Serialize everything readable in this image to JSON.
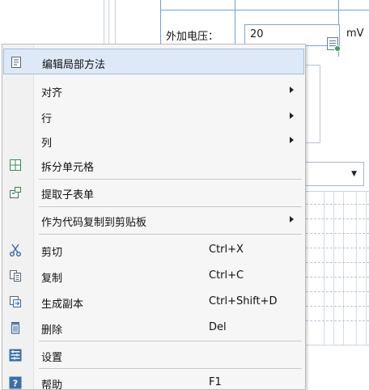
{
  "form": {
    "field_label": "外加电压：",
    "field_value": "20",
    "field_unit": "mV"
  },
  "menu": {
    "items": [
      {
        "label": "编辑局部方法",
        "icon": "edit-method-icon",
        "shortcut": "",
        "submenu": false
      },
      {
        "label": "对齐",
        "icon": "",
        "shortcut": "",
        "submenu": true
      },
      {
        "label": "行",
        "icon": "",
        "shortcut": "",
        "submenu": true
      },
      {
        "label": "列",
        "icon": "",
        "shortcut": "",
        "submenu": true
      },
      {
        "label": "拆分单元格",
        "icon": "split-cells-icon",
        "shortcut": "",
        "submenu": false
      },
      {
        "label": "提取子表单",
        "icon": "extract-subform-icon",
        "shortcut": "",
        "submenu": false
      },
      {
        "label": "作为代码复制到剪贴板",
        "icon": "",
        "shortcut": "",
        "submenu": true
      },
      {
        "label": "剪切",
        "icon": "scissors-icon",
        "shortcut": "Ctrl+X",
        "submenu": false
      },
      {
        "label": "复制",
        "icon": "copy-icon",
        "shortcut": "Ctrl+C",
        "submenu": false
      },
      {
        "label": "生成副本",
        "icon": "duplicate-icon",
        "shortcut": "Ctrl+Shift+D",
        "submenu": false
      },
      {
        "label": "删除",
        "icon": "trash-icon",
        "shortcut": "Del",
        "submenu": false
      },
      {
        "label": "设置",
        "icon": "settings-icon",
        "shortcut": "",
        "submenu": false
      },
      {
        "label": "帮助",
        "icon": "help-icon",
        "shortcut": "F1",
        "submenu": false
      }
    ]
  },
  "colors": {
    "highlight": "#dde9f6",
    "icon_blue": "#3a6ea8",
    "icon_green": "#2e8b57"
  }
}
